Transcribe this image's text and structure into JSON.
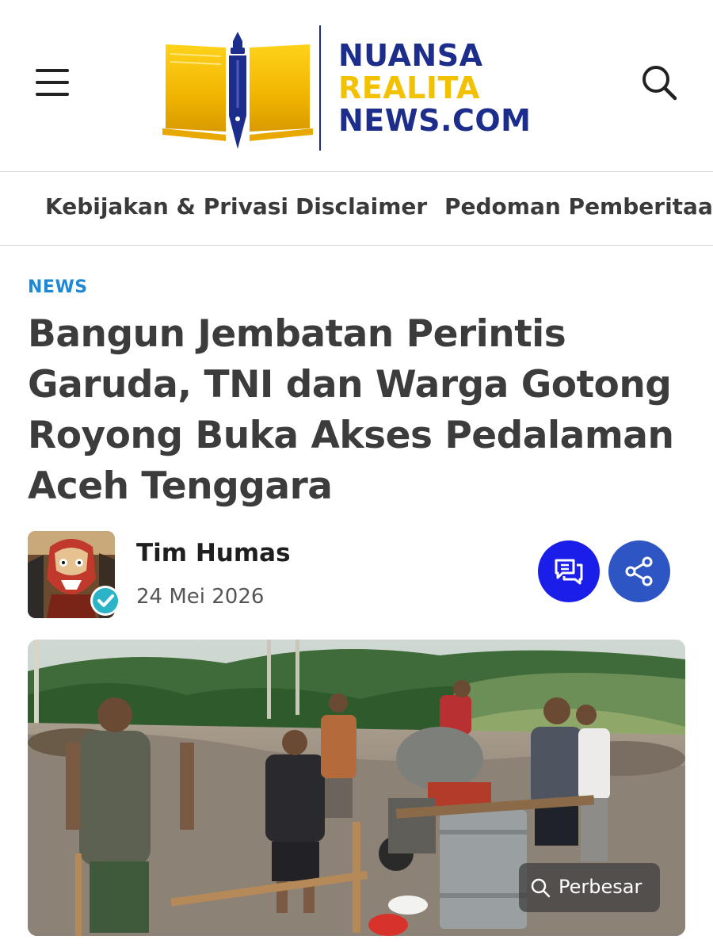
{
  "brand": {
    "line1": "NUANSA",
    "line2": "REALITA",
    "line3": "NEWS.COM",
    "primary_color": "#1c2d8c",
    "accent_color": "#f2c200"
  },
  "header": {
    "menu_icon": "hamburger-menu-icon",
    "search_icon": "search-icon"
  },
  "nav": {
    "items": [
      {
        "label": "Kebijakan & Privasi"
      },
      {
        "label": "Disclaimer"
      },
      {
        "label": "Pedoman Pemberitaan"
      }
    ]
  },
  "article": {
    "category": "NEWS",
    "title": "Bangun Jembatan Perintis Garuda, TNI dan Warga Gotong Royong Buka Akses Pedalaman Aceh Tenggara",
    "author": "Tim Humas",
    "date": "24 Mei 2026",
    "comment_icon": "comment-icon",
    "share_icon": "share-icon",
    "enlarge_label": "Perbesar",
    "category_color": "#1e88d4"
  }
}
